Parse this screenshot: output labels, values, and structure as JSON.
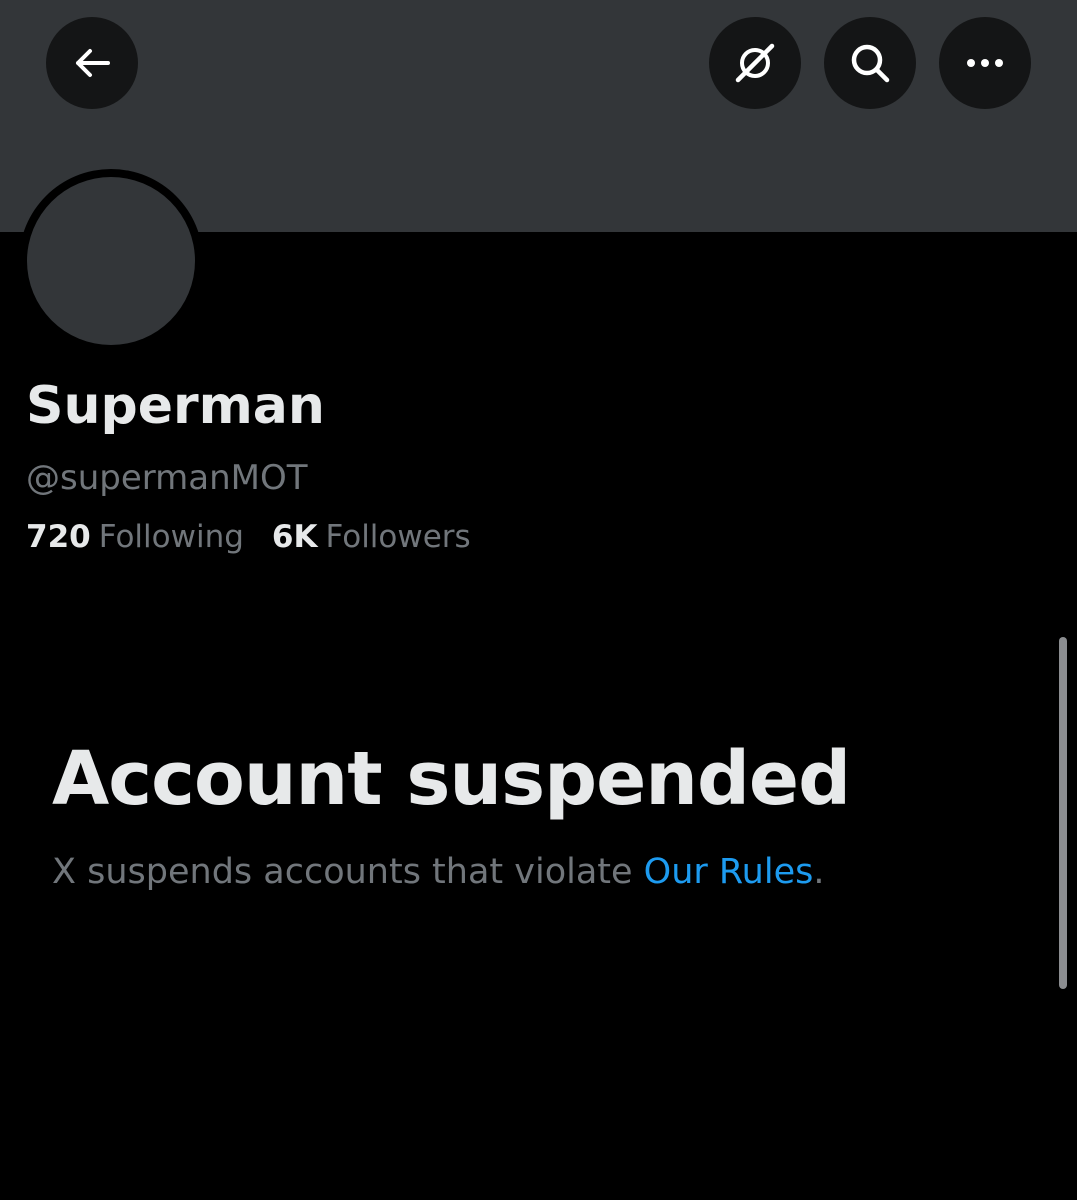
{
  "header": {
    "icons": [
      "back-arrow-icon",
      "grok-icon",
      "search-icon",
      "more-icon"
    ]
  },
  "profile": {
    "display_name": "Superman",
    "handle": "@supermanMOT",
    "following_count": "720",
    "following_label": "Following",
    "followers_count": "6K",
    "followers_label": "Followers"
  },
  "suspension": {
    "title": "Account suspended",
    "message_prefix": "X suspends accounts that violate ",
    "rules_link": "Our Rules",
    "message_suffix": "."
  },
  "colors": {
    "background": "#000000",
    "banner": "#333639",
    "primary_text": "#e7e9ea",
    "secondary_text": "#71767b",
    "link": "#1d9bf0"
  }
}
